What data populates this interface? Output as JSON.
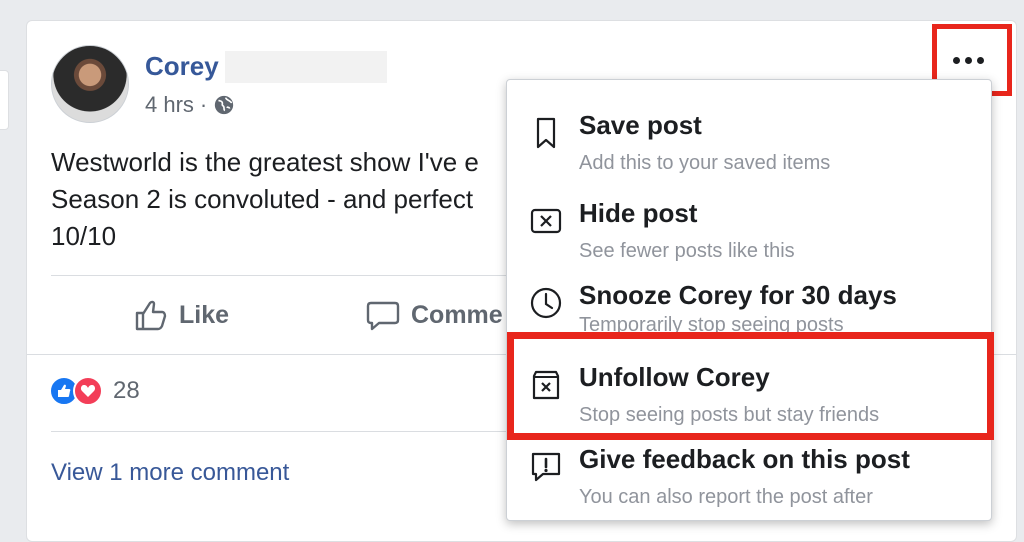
{
  "post": {
    "author_first_name": "Corey",
    "time": "4 hrs",
    "separator": "·",
    "text_line1": "Westworld is the greatest show I've e",
    "text_line2": "Season 2 is convoluted - and perfect",
    "text_line3": "10/10"
  },
  "actions": {
    "like_label": "Like",
    "comment_label": "Comme"
  },
  "reactions": {
    "count": "28"
  },
  "comments": {
    "view_more_label": "View 1 more comment"
  },
  "menu": {
    "items": [
      {
        "title": "Save post",
        "subtitle": "Add this to your saved items",
        "icon": "bookmark-icon"
      },
      {
        "title": "Hide post",
        "subtitle": "See fewer posts like this",
        "icon": "hide-post-icon"
      },
      {
        "title": "Snooze Corey for 30 days",
        "subtitle": "Temporarily stop seeing posts",
        "icon": "clock-icon"
      },
      {
        "title": "Unfollow Corey",
        "subtitle": "Stop seeing posts but stay friends",
        "icon": "unfollow-icon"
      },
      {
        "title": "Give feedback on this post",
        "subtitle": "You can also report the post after",
        "icon": "feedback-icon"
      }
    ]
  },
  "colors": {
    "highlight": "#e8261c",
    "link": "#365899",
    "like_blue": "#1877f2",
    "love_red": "#f33e58"
  }
}
